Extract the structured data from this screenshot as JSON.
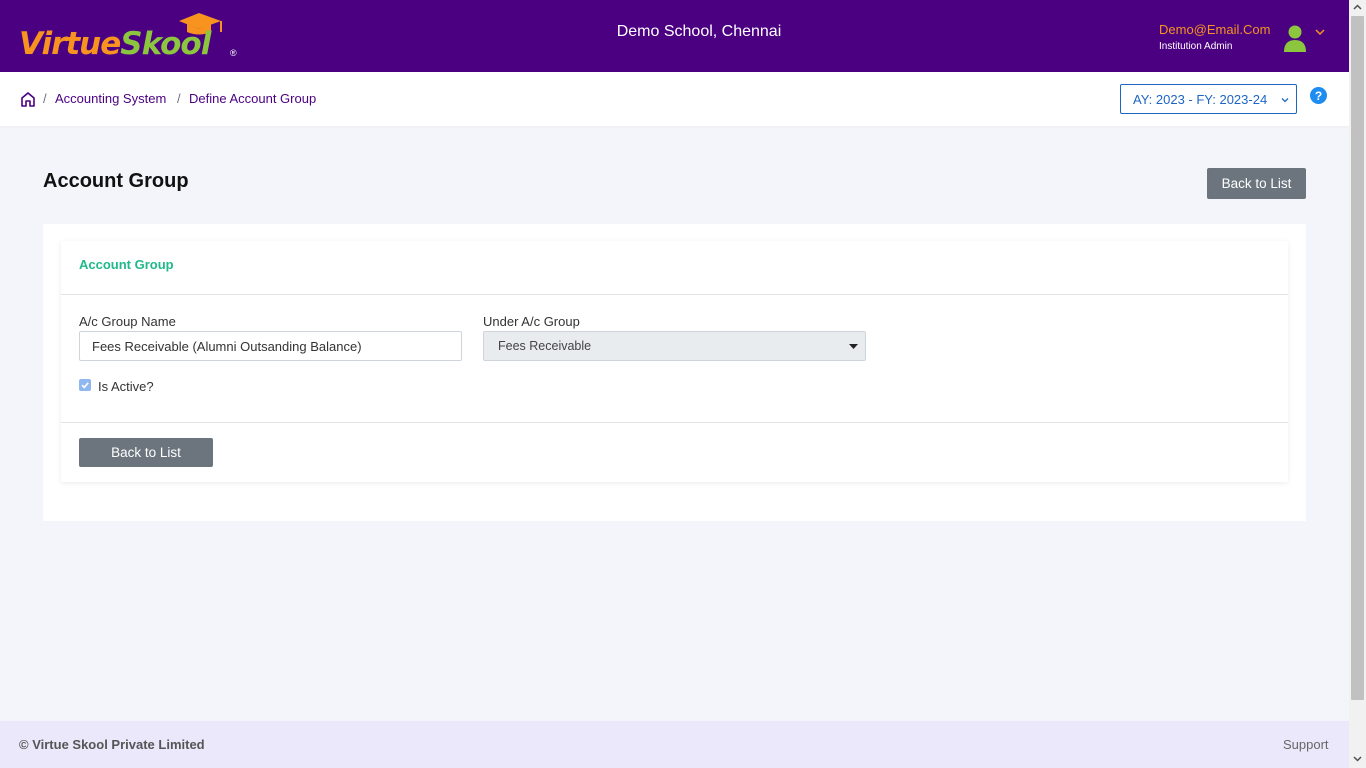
{
  "header": {
    "logo_part1": "Virtue",
    "logo_part2": "Skool",
    "logo_registered": "®",
    "school_name": "Demo School, Chennai",
    "user_email": "Demo@Email.Com",
    "user_role": "Institution Admin"
  },
  "breadcrumb": {
    "items": [
      "Accounting System",
      "Define Account Group"
    ],
    "separator": "/"
  },
  "year_selector": {
    "value": "AY: 2023 - FY: 2023-24"
  },
  "page": {
    "title": "Account Group",
    "back_button_label": "Back to List"
  },
  "form": {
    "section_title": "Account Group",
    "group_name_label": "A/c Group Name",
    "group_name_value": "Fees Receivable (Alumni Outsanding Balance)",
    "under_group_label": "Under A/c Group",
    "under_group_value": "Fees Receivable",
    "is_active_label": "Is Active?",
    "is_active": true,
    "back_button_label": "Back to List"
  },
  "footer": {
    "copyright": "© Virtue Skool Private Limited",
    "support_label": "Support"
  },
  "colors": {
    "header_bg": "#4b0082",
    "accent_orange": "#f7931e",
    "accent_green": "#8cc63f",
    "section_title": "#20b98a",
    "link": "#4b0082",
    "button": "#6c757d",
    "year_select": "#1e66c4"
  }
}
